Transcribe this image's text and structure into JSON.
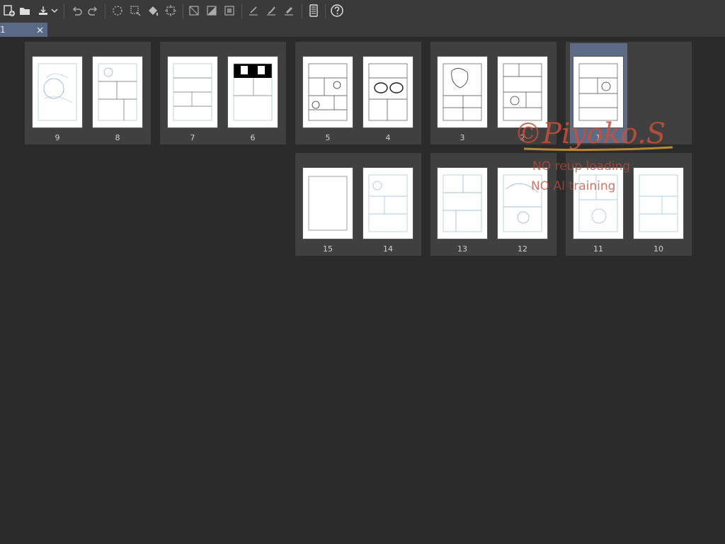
{
  "tab": {
    "label": "1"
  },
  "toolbar": {
    "buttons": [
      "new-page-icon",
      "open-folder-icon",
      "export-icon",
      "dropdown-chevron-icon",
      "undo-icon",
      "redo-icon",
      "selection-icon",
      "transform-icon",
      "fill-icon",
      "crop-icon",
      "ruler-icon",
      "tone-icon",
      "frame-icon",
      "pen-icon",
      "brush-icon",
      "eraser-icon",
      "device-icon",
      "help-icon"
    ]
  },
  "pages": [
    {
      "num": "9"
    },
    {
      "num": "8"
    },
    {
      "num": "7"
    },
    {
      "num": "6"
    },
    {
      "num": "5"
    },
    {
      "num": "4"
    },
    {
      "num": "3"
    },
    {
      "num": "2"
    },
    {
      "num": "1"
    },
    {
      "num": "15"
    },
    {
      "num": "14"
    },
    {
      "num": "13"
    },
    {
      "num": "12"
    },
    {
      "num": "11"
    },
    {
      "num": "10"
    }
  ],
  "watermark": {
    "line1": "©Piyoko.S",
    "line2": "NO reup loading",
    "line3": "NO AI training"
  }
}
